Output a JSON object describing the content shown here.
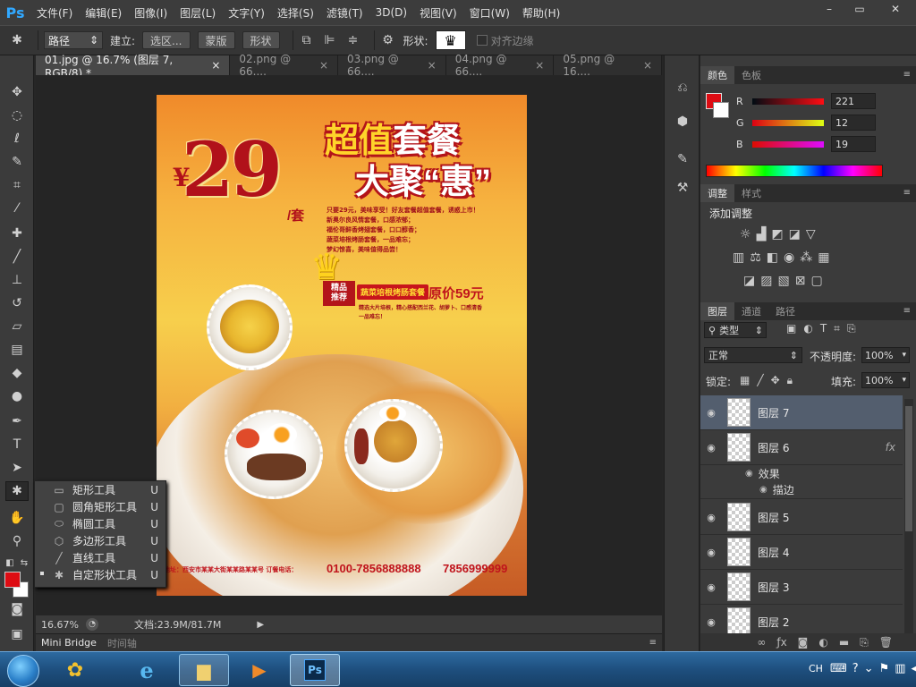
{
  "app": {
    "logo": "Ps"
  },
  "menu": [
    "文件(F)",
    "编辑(E)",
    "图像(I)",
    "图层(L)",
    "文字(Y)",
    "选择(S)",
    "滤镜(T)",
    "3D(D)",
    "视图(V)",
    "窗口(W)",
    "帮助(H)"
  ],
  "window_controls": {
    "minimize": "–",
    "restore": "▭",
    "close": "✕"
  },
  "options": {
    "mode": "路径",
    "build_label": "建立:",
    "selection_btn": "选区...",
    "mask_btn": "蒙版",
    "shape_btn": "形状",
    "shape_label": "形状:",
    "align_edges": "对齐边缘"
  },
  "tabs": [
    "01.jpg @ 16.7% (图层 7, RGB/8) *",
    "02.png @ 66....",
    "03.png @ 66....",
    "04.png @ 66....",
    "05.png @ 16...."
  ],
  "poster": {
    "yen": "¥",
    "price": "29",
    "price_unit": "/套",
    "headline1_a": "超值",
    "headline1_b": "套餐",
    "headline2": "大聚“惠”",
    "desc": [
      "只要29元，美味享受！好友套餐超值套餐，诱惑上市！",
      "新奥尔良风情套餐，口感浓郁；",
      "福伦哥鲜香烤翅套餐，口口醇香；",
      "蔬菜培根烤肠套餐，一品难忘；",
      "梦幻惊喜，美味值得品尝！"
    ],
    "badge_line1": "精品",
    "badge_line2": "推荐",
    "promo_name": "蔬菜培根烤肠套餐",
    "orig_price": "原价59元",
    "promo_desc": [
      "精选大片培根，精心搭配西兰花、胡萝卜、口感清香",
      "一品难忘！"
    ],
    "footer_text": "地址：西安市某某大街某某路某某号  订餐电话：",
    "phone1": "0100-7856888888",
    "phone2": "7856999999"
  },
  "status": {
    "zoom": "16.67%",
    "doc": "文档:23.9M/81.7M"
  },
  "bottom_tabs": [
    "Mini Bridge",
    "时间轴"
  ],
  "flyout": [
    {
      "label": "矩形工具",
      "key": "U",
      "icon": "rect-icon",
      "selected": false
    },
    {
      "label": "圆角矩形工具",
      "key": "U",
      "icon": "rounded-rect-icon",
      "selected": false
    },
    {
      "label": "椭圆工具",
      "key": "U",
      "icon": "ellipse-icon",
      "selected": false
    },
    {
      "label": "多边形工具",
      "key": "U",
      "icon": "polygon-icon",
      "selected": false
    },
    {
      "label": "直线工具",
      "key": "U",
      "icon": "line-icon",
      "selected": false
    },
    {
      "label": "自定形状工具",
      "key": "U",
      "icon": "custom-shape-icon",
      "selected": true
    }
  ],
  "color_panel": {
    "tabs": [
      "颜色",
      "色板"
    ],
    "r": {
      "label": "R",
      "value": "221"
    },
    "g": {
      "label": "G",
      "value": "12"
    },
    "b": {
      "label": "B",
      "value": "19"
    },
    "fg_color": "#dd0c13"
  },
  "adjust_panel": {
    "tabs": [
      "调整",
      "样式"
    ],
    "title": "添加调整"
  },
  "layers_panel": {
    "tabs": [
      "图层",
      "通道",
      "路径"
    ],
    "filter_label": "类型",
    "blend_mode": "正常",
    "opacity_label": "不透明度:",
    "opacity_value": "100%",
    "lock_label": "锁定:",
    "fill_label": "填充:",
    "fill_value": "100%",
    "layers": [
      "图层 7",
      "图层 6",
      "图层 5",
      "图层 4",
      "图层 3",
      "图层 2"
    ],
    "fx": "fx",
    "effects_label": "效果",
    "stroke_label": "描边"
  },
  "taskbar": {
    "ime": "CH"
  }
}
